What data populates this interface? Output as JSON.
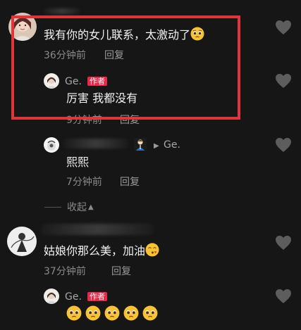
{
  "comments": [
    {
      "text": "我有你的女儿联系，太激动了",
      "emoji": "pleading-face",
      "time": "36分钟前",
      "reply_label": "回复",
      "replies": [
        {
          "author": "Ge.",
          "badge": "作者",
          "text": "厉害 我都没有",
          "time": "9分钟前",
          "reply_label": "回复"
        },
        {
          "author": "Ge.",
          "reply_target_arrow": "▶",
          "text": "熙熙",
          "time": "7分钟前",
          "reply_label": "回复"
        }
      ],
      "collapse_label": "收起",
      "collapse_arrow": "▲"
    },
    {
      "text": "姑娘你那么美，加油",
      "emoji": "face-blowing-kiss",
      "time": "37分钟前",
      "reply_label": "回复",
      "replies": [
        {
          "author": "Ge.",
          "badge": "作者",
          "emoji_count": 5,
          "emoji": "pleading-face"
        }
      ]
    }
  ],
  "colors": {
    "background": "#161616",
    "highlight": "#e0353a",
    "badge": "#e8294a",
    "meta": "#8a8a8a"
  },
  "icons": {
    "like": "heart-icon"
  }
}
